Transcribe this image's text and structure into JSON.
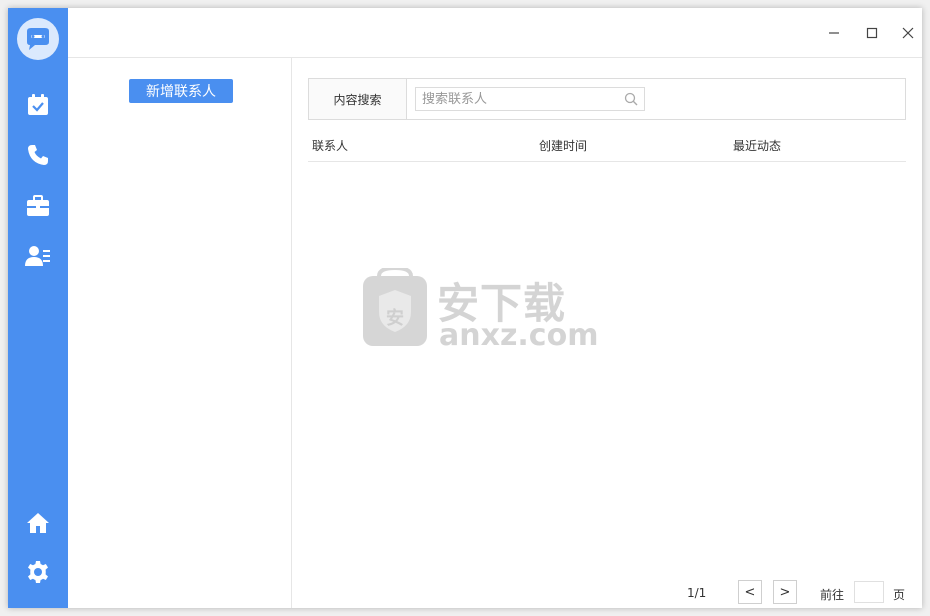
{
  "left_panel": {
    "add_contact_label": "新增联系人"
  },
  "search": {
    "label": "内容搜索",
    "placeholder": "搜索联系人",
    "value": ""
  },
  "table": {
    "columns": [
      "联系人",
      "创建时间",
      "最近动态"
    ],
    "rows": []
  },
  "watermark": {
    "glyph": "安",
    "title": "安下载",
    "domain": "anxz.com"
  },
  "pagination": {
    "page_indicator": "1/1",
    "prev_label": "<",
    "next_label": ">",
    "goto_label": "前往",
    "page_suffix": "页",
    "goto_value": ""
  },
  "colors": {
    "sidebar": "#4a8ff0",
    "primary_button": "#4a8ff0"
  },
  "sidebar_icons": [
    "chat-logo-icon",
    "calendar-check-icon",
    "phone-icon",
    "briefcase-icon",
    "contact-card-icon",
    "home-icon",
    "gear-icon"
  ]
}
